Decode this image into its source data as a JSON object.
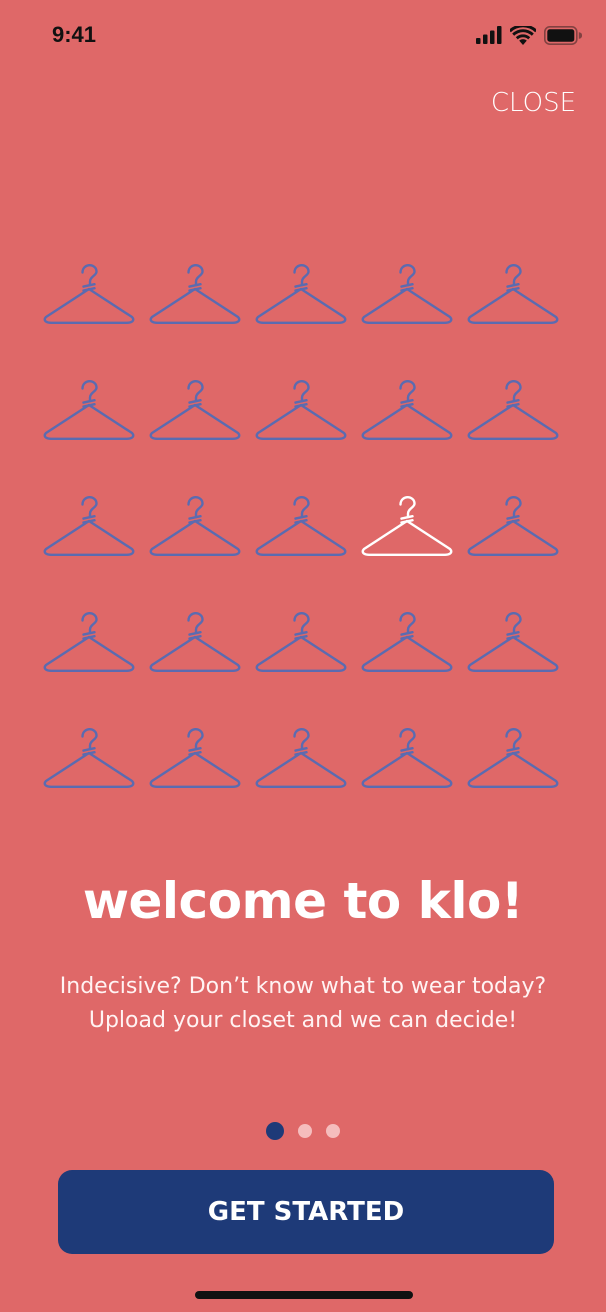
{
  "status_bar": {
    "time": "9:41",
    "icons": [
      "cellular-signal-icon",
      "wifi-icon",
      "battery-icon"
    ]
  },
  "header": {
    "close_label": "CLOSE"
  },
  "hanger_grid": {
    "rows": 5,
    "cols": 5,
    "highlighted_row": 3,
    "highlighted_col": 4,
    "hanger_color": "#5b6bb0",
    "highlight_color": "#ffffff",
    "icon": "hanger-icon"
  },
  "welcome": {
    "title": "welcome to klo!",
    "subtitle_line1": "Indecisive? Don’t know what to wear today?",
    "subtitle_line2": "Upload your closet and we can decide!"
  },
  "pagination": {
    "total": 3,
    "current": 1
  },
  "cta": {
    "label": "GET STARTED"
  },
  "colors": {
    "background": "#df6868",
    "primary": "#1e3a78",
    "dot_inactive": "#f5bdbd"
  }
}
